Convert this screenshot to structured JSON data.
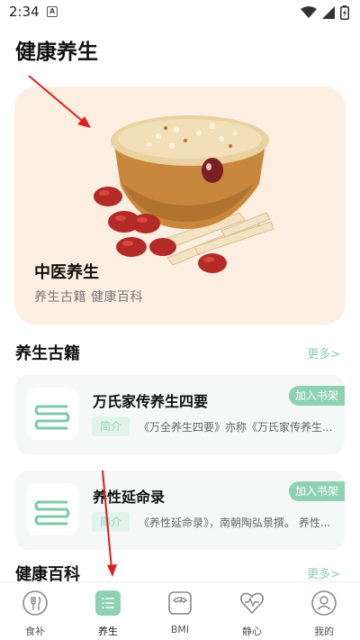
{
  "status_bar": {
    "time": "2:34",
    "notif_badge": "A"
  },
  "page": {
    "title": "健康养生"
  },
  "banner": {
    "title": "中医养生",
    "subtitle": "养生古籍 健康百科"
  },
  "sections": {
    "books": {
      "title": "养生古籍",
      "more": "更多>"
    },
    "encyclopedia": {
      "title": "健康百科",
      "more": "更多>"
    }
  },
  "books": [
    {
      "title": "万氏家传养生四要",
      "tag": "简介",
      "desc": "《万全养生四要》亦称《万氏家传养生...",
      "action": "加入书架"
    },
    {
      "title": "养性延命录",
      "tag": "简介",
      "desc": "《养性延命录》，南朝陶弘景撰。 养性...",
      "action": "加入书架"
    }
  ],
  "tabs": [
    {
      "label": "食补",
      "icon": "food-icon"
    },
    {
      "label": "养生",
      "icon": "list-icon"
    },
    {
      "label": "BMI",
      "icon": "scale-icon"
    },
    {
      "label": "静心",
      "icon": "heart-icon"
    },
    {
      "label": "我的",
      "icon": "profile-icon"
    }
  ],
  "active_tab": "养生",
  "colors": {
    "accent": "#8fd2b3",
    "banner_bg": "#fdeee2",
    "annotation": "#e02020"
  }
}
